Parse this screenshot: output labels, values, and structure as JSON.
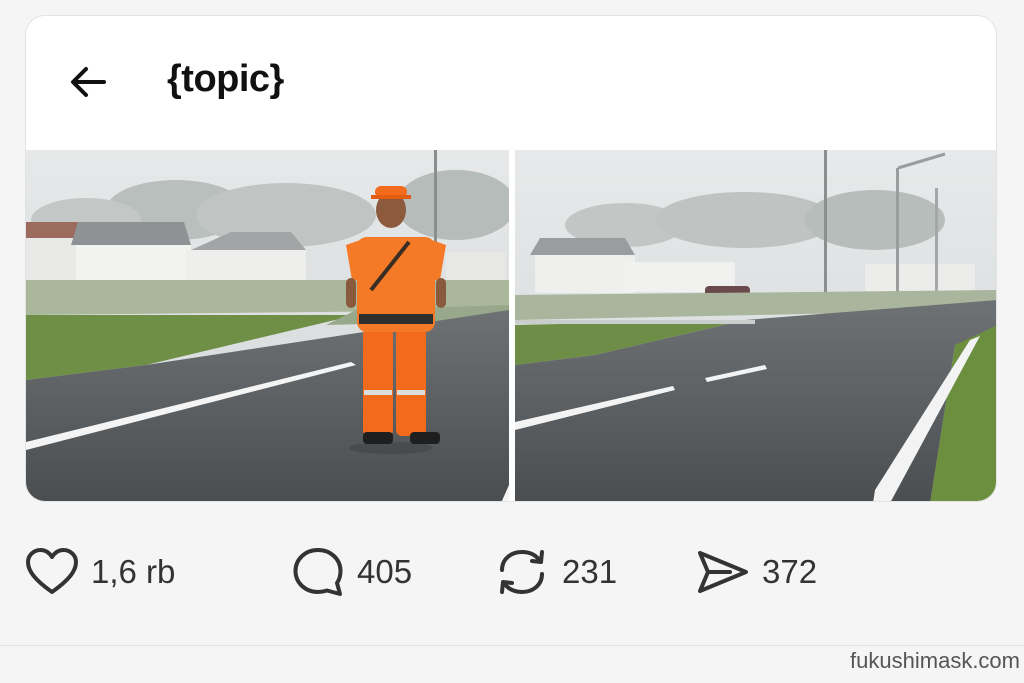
{
  "header": {
    "title": "{topic}",
    "back_icon": "arrow-left-icon"
  },
  "media": {
    "photos": [
      {
        "subject": "worker-in-orange-uniform-on-road"
      },
      {
        "subject": "empty-road-in-fog"
      }
    ]
  },
  "actions": {
    "like_count": "1,6 rb",
    "reply_count": "405",
    "repost_count": "231",
    "share_count": "372"
  },
  "watermark": "fukushimask.com",
  "colors": {
    "text": "#111111",
    "count": "#333333",
    "uniform": "#f26a1b"
  }
}
